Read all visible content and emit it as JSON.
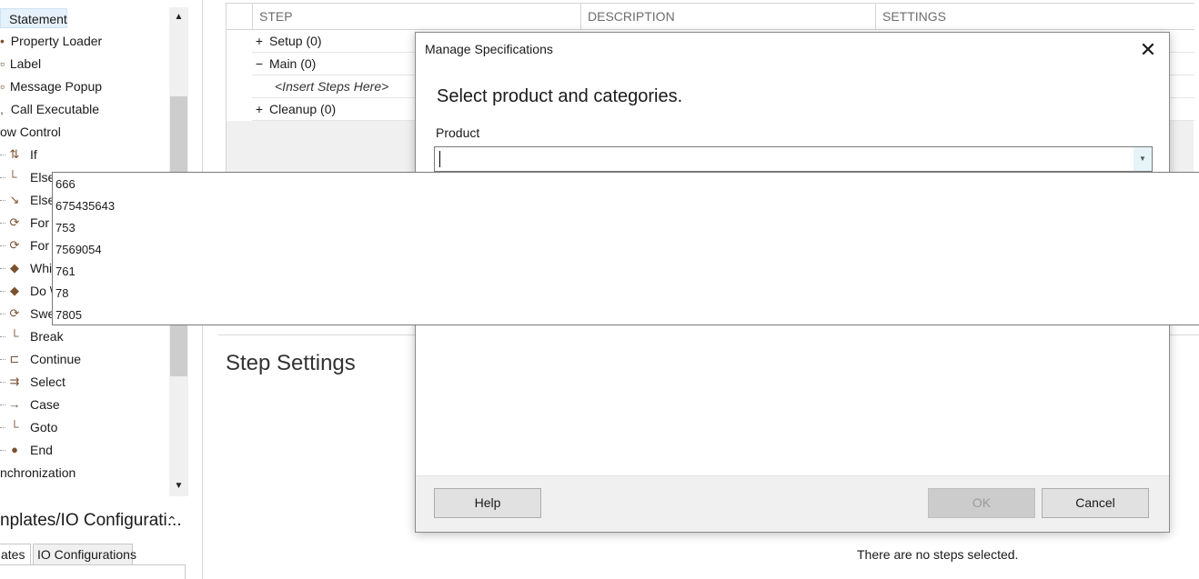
{
  "tree": {
    "items": [
      {
        "label": "Statement",
        "icon": "statement-icon"
      },
      {
        "label": "Property Loader",
        "icon": "property-loader-icon"
      },
      {
        "label": "Label",
        "icon": "label-icon"
      },
      {
        "label": "Message Popup",
        "icon": "message-popup-icon"
      },
      {
        "label": "Call Executable",
        "icon": "call-executable-icon"
      },
      {
        "label": "ow Control",
        "icon": ""
      },
      {
        "label": "If",
        "icon": "if-icon"
      },
      {
        "label": "Else",
        "icon": "else-icon"
      },
      {
        "label": "Else",
        "icon": "else-if-icon"
      },
      {
        "label": "For",
        "icon": "for-icon"
      },
      {
        "label": "For",
        "icon": "for-each-icon"
      },
      {
        "label": "Whi",
        "icon": "while-icon"
      },
      {
        "label": "Do \\",
        "icon": "do-while-icon"
      },
      {
        "label": "Swe",
        "icon": "sweep-icon"
      },
      {
        "label": "Break",
        "icon": "break-icon"
      },
      {
        "label": "Continue",
        "icon": "continue-icon"
      },
      {
        "label": "Select",
        "icon": "select-icon"
      },
      {
        "label": "Case",
        "icon": "case-icon"
      },
      {
        "label": "Goto",
        "icon": "goto-icon"
      },
      {
        "label": "End",
        "icon": "end-icon"
      },
      {
        "label": "nchronization",
        "icon": ""
      }
    ]
  },
  "templates": {
    "header": "nplates/IO Configurati...",
    "tabs": [
      "ates",
      "IO Configurations"
    ]
  },
  "grid": {
    "columns": [
      "STEP",
      "DESCRIPTION",
      "SETTINGS"
    ],
    "rows": [
      {
        "sign": "+",
        "label": "Setup (0)"
      },
      {
        "sign": "−",
        "label": "Main (0)"
      },
      {
        "sign": "",
        "label": "<Insert Steps Here>"
      },
      {
        "sign": "+",
        "label": "Cleanup (0)"
      }
    ]
  },
  "settings": {
    "title": "Step Settings",
    "empty_message": "There are no steps selected."
  },
  "dialog": {
    "title": "Manage Specifications",
    "heading": "Select product and categories.",
    "product_label": "Product",
    "product_value": "",
    "help": "Help",
    "ok": "OK",
    "cancel": "Cancel"
  },
  "dropdown": {
    "options": [
      "666",
      "675435643",
      "753",
      "7569054",
      "761",
      "78",
      "7805"
    ]
  }
}
